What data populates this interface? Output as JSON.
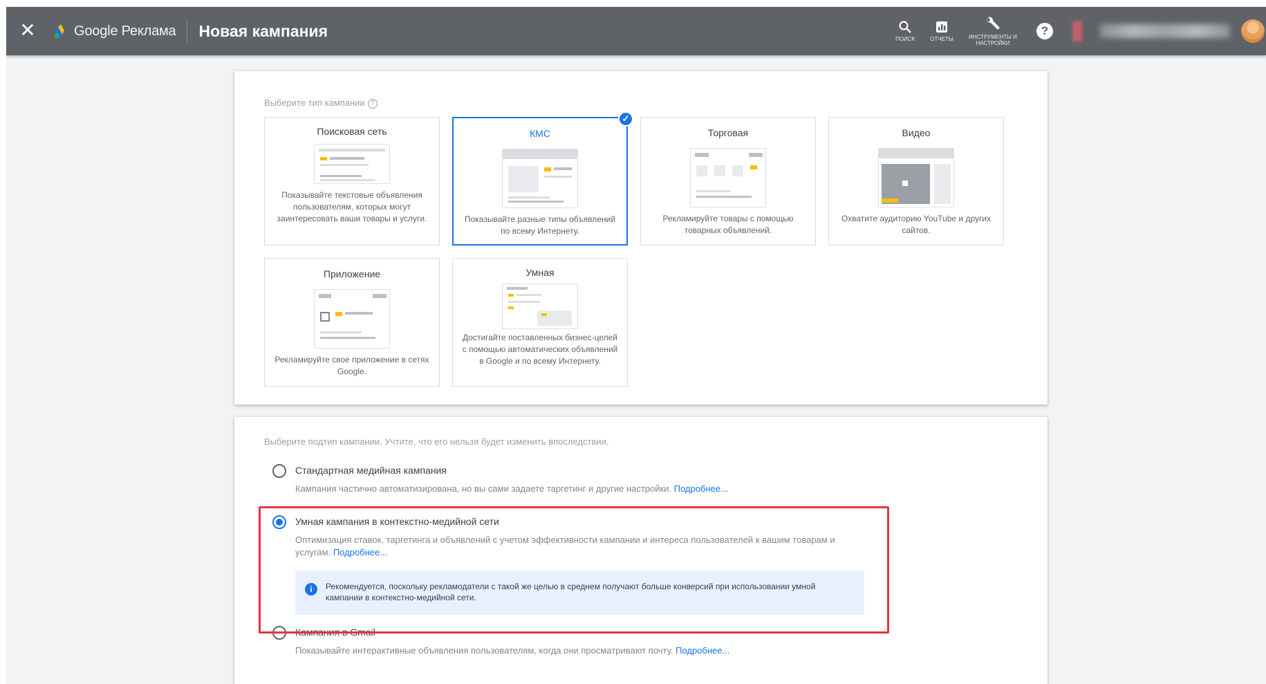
{
  "header": {
    "close_icon": "close-icon",
    "logo_text": "Google Реклама",
    "page_title": "Новая кампания",
    "tools": [
      {
        "icon": "search-icon",
        "label": "Поиск"
      },
      {
        "icon": "reports-icon",
        "label": "Отчеты"
      },
      {
        "icon": "wrench-icon",
        "label": "Инструменты и настройки"
      }
    ],
    "help_icon": "help-icon"
  },
  "campaign_type": {
    "label": "Выберите тип кампании",
    "tiles": [
      {
        "title": "Поисковая сеть",
        "desc": "Показывайте текстовые объявления пользователям, которых могут заинтересовать ваши товары и услуги.",
        "selected": false
      },
      {
        "title": "КМС",
        "desc": "Показывайте разные типы объявлений по всему Интернету.",
        "selected": true
      },
      {
        "title": "Торговая",
        "desc": "Рекламируйте товары с помощью товарных объявлений.",
        "selected": false
      },
      {
        "title": "Видео",
        "desc": "Охватите аудиторию YouTube и других сайтов.",
        "selected": false
      },
      {
        "title": "Приложение",
        "desc": "Рекламируйте свое приложение в сетях Google.",
        "selected": false
      },
      {
        "title": "Умная",
        "desc": "Достигайте поставленных бизнес-целей с помощью автоматических объявлений в Google и по всему Интернету.",
        "selected": false
      }
    ]
  },
  "subtype": {
    "label": "Выберите подтип кампании. Учтите, что его нельзя будет изменить впоследствии.",
    "learn_more": "Подробнее...",
    "options": [
      {
        "title": "Стандартная медийная кампания",
        "desc": "Кампания частично автоматизирована, но вы сами задаете таргетинг и другие настройки.",
        "checked": false
      },
      {
        "title": "Умная кампания в контекстно-медийной сети",
        "desc": "Оптимизация ставок, таргетинга и объявлений с учетом эффективности кампании и интереса пользователей к вашим товарам и услугам.",
        "checked": true
      },
      {
        "title": "Кампания в Gmail",
        "desc": "Показывайте интерактивные объявления пользователям, когда они просматривают почту.",
        "checked": false
      }
    ],
    "recommendation": "Рекомендуется, поскольку рекламодатели с такой же целью в среднем получают больше конверсий при использовании умной кампании в контекстно-медийной сети."
  },
  "colors": {
    "accent": "#1a73e8",
    "header": "#5f6368",
    "highlight": "#e8323c",
    "info_bg": "#e8f0fe"
  }
}
